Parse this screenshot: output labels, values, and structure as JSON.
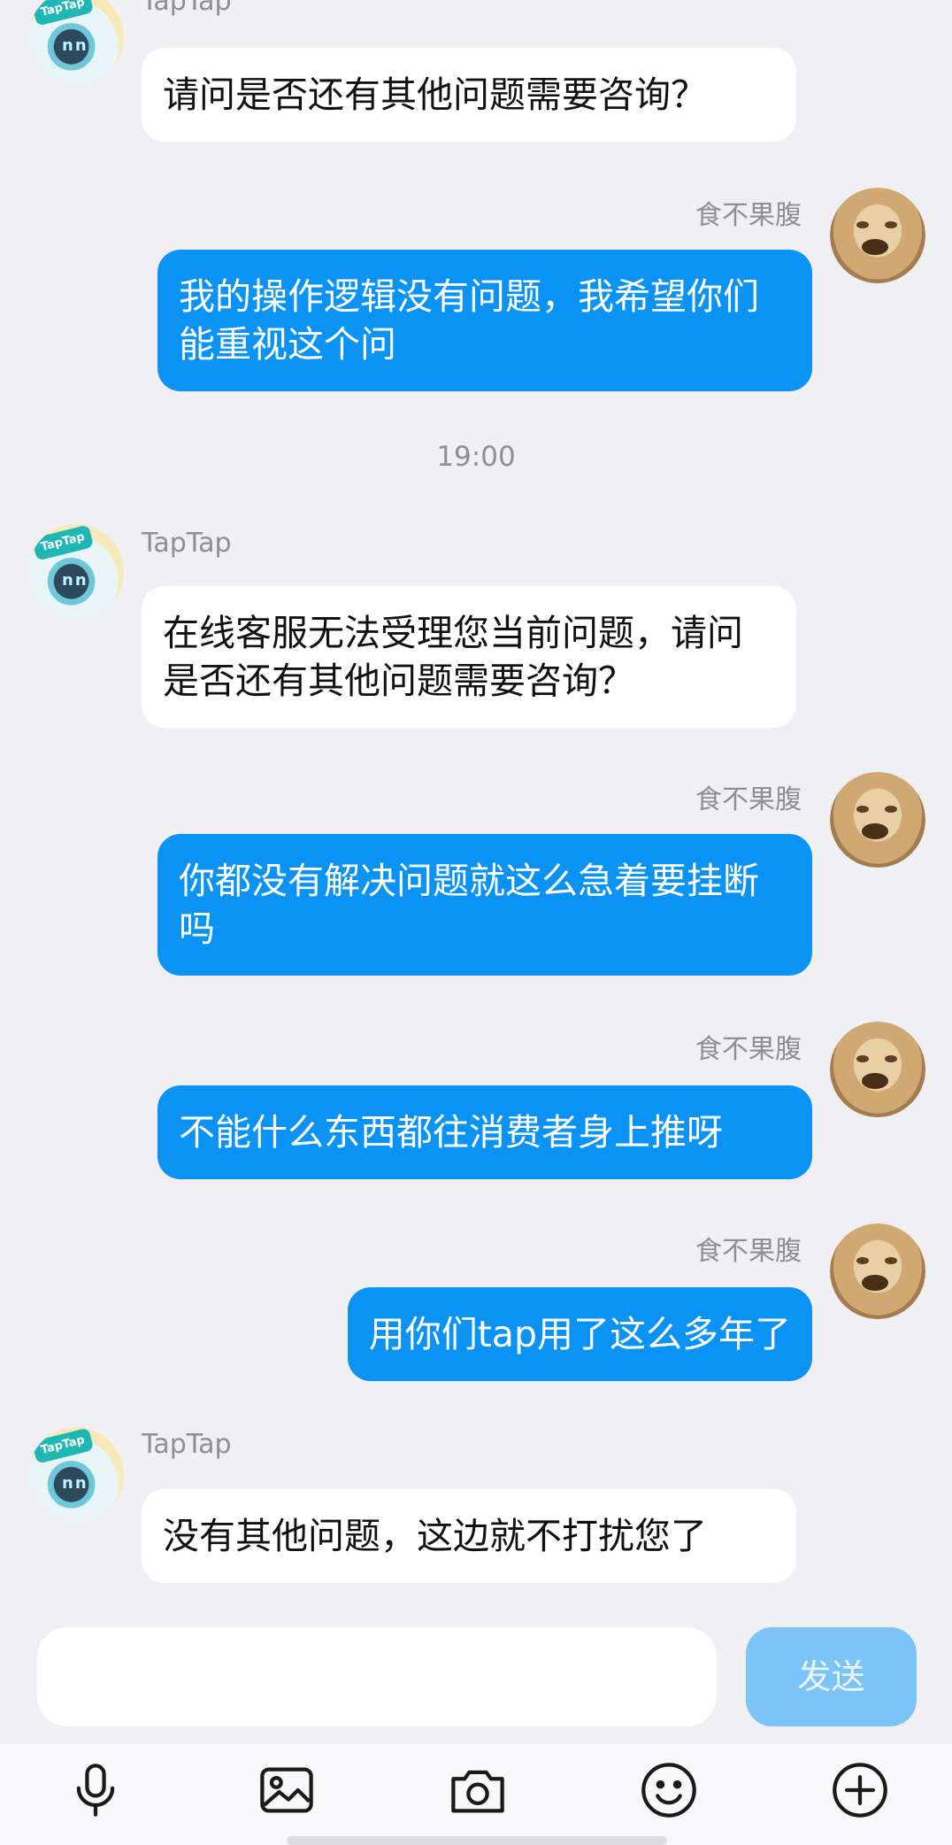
{
  "messages": [
    {
      "side": "bot",
      "sender": "TapTap",
      "text": "请问是否还有其他问题需要咨询？"
    },
    {
      "side": "user",
      "sender": "食不果腹",
      "text": "我的操作逻辑没有问题，我希望你们能重视这个问"
    },
    {
      "timestamp": "19:00"
    },
    {
      "side": "bot",
      "sender": "TapTap",
      "text": "在线客服无法受理您当前问题，请问是否还有其他问题需要咨询？"
    },
    {
      "side": "user",
      "sender": "食不果腹",
      "text": "你都没有解决问题就这么急着要挂断吗"
    },
    {
      "side": "user",
      "sender": "食不果腹",
      "text": "不能什么东西都往消费者身上推呀"
    },
    {
      "side": "user",
      "sender": "食不果腹",
      "text": "用你们tap用了这么多年了"
    },
    {
      "side": "bot",
      "sender": "TapTap",
      "text": "没有其他问题，这边就不打扰您了"
    }
  ],
  "bot_avatar_badge": "TapTap",
  "input": {
    "value": "",
    "placeholder": ""
  },
  "send_label": "发送",
  "toolbar_icons": [
    "microphone-icon",
    "image-icon",
    "camera-icon",
    "emoji-icon",
    "plus-icon"
  ],
  "colors": {
    "user_bubble": "#0a93f5",
    "send_button_disabled": "#7cc3f8",
    "background": "#efeff4"
  }
}
